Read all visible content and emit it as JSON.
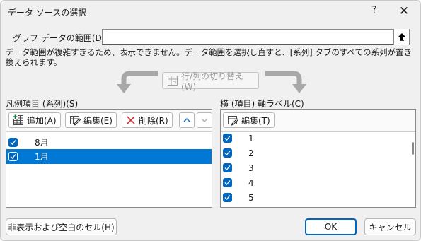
{
  "window": {
    "title": "データ ソースの選択",
    "help": "?",
    "close": "✕"
  },
  "range": {
    "label": "グラフ データの範囲(D):",
    "value": ""
  },
  "warning": "データ範囲が複雑すぎるため、表示できません。データ範囲を選択し直すと、[系列] タブのすべての系列が置き換えられます。",
  "switch_button": "行/列の切り替え(W)",
  "series_panel": {
    "label": "凡例項目 (系列)(S)",
    "add": "追加(A)",
    "edit": "編集(E)",
    "remove": "削除(R)",
    "items": [
      {
        "label": "8月",
        "checked": true,
        "selected": false
      },
      {
        "label": "1月",
        "checked": true,
        "selected": true
      }
    ]
  },
  "axis_panel": {
    "label": "横 (項目) 軸ラベル(C)",
    "edit": "編集(T)",
    "items": [
      {
        "label": "1",
        "checked": true
      },
      {
        "label": "2",
        "checked": true
      },
      {
        "label": "3",
        "checked": true
      },
      {
        "label": "4",
        "checked": true
      },
      {
        "label": "5",
        "checked": true
      }
    ]
  },
  "buttons": {
    "hidden_cells": "非表示および空白のセル(H)",
    "ok": "OK",
    "cancel": "キャンセル"
  },
  "colors": {
    "accent": "#0067c0",
    "selection": "#0078d4",
    "delete_icon": "#d13438"
  }
}
